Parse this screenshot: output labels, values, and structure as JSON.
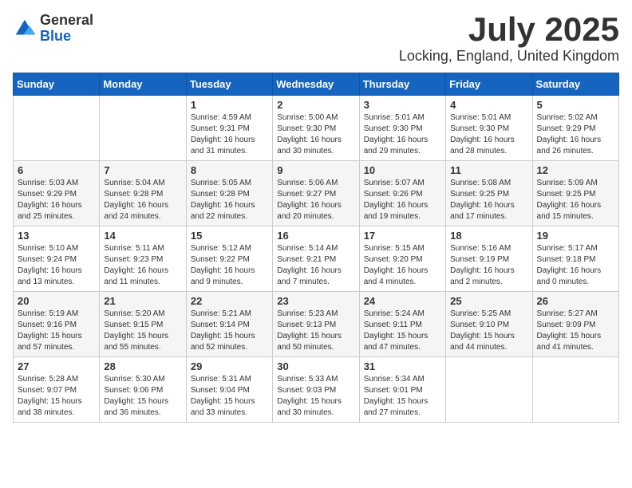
{
  "logo": {
    "general": "General",
    "blue": "Blue"
  },
  "title": {
    "month": "July 2025",
    "location": "Locking, England, United Kingdom"
  },
  "weekdays": [
    "Sunday",
    "Monday",
    "Tuesday",
    "Wednesday",
    "Thursday",
    "Friday",
    "Saturday"
  ],
  "weeks": [
    [
      {
        "day": "",
        "info": ""
      },
      {
        "day": "",
        "info": ""
      },
      {
        "day": "1",
        "info": "Sunrise: 4:59 AM\nSunset: 9:31 PM\nDaylight: 16 hours\nand 31 minutes."
      },
      {
        "day": "2",
        "info": "Sunrise: 5:00 AM\nSunset: 9:30 PM\nDaylight: 16 hours\nand 30 minutes."
      },
      {
        "day": "3",
        "info": "Sunrise: 5:01 AM\nSunset: 9:30 PM\nDaylight: 16 hours\nand 29 minutes."
      },
      {
        "day": "4",
        "info": "Sunrise: 5:01 AM\nSunset: 9:30 PM\nDaylight: 16 hours\nand 28 minutes."
      },
      {
        "day": "5",
        "info": "Sunrise: 5:02 AM\nSunset: 9:29 PM\nDaylight: 16 hours\nand 26 minutes."
      }
    ],
    [
      {
        "day": "6",
        "info": "Sunrise: 5:03 AM\nSunset: 9:29 PM\nDaylight: 16 hours\nand 25 minutes."
      },
      {
        "day": "7",
        "info": "Sunrise: 5:04 AM\nSunset: 9:28 PM\nDaylight: 16 hours\nand 24 minutes."
      },
      {
        "day": "8",
        "info": "Sunrise: 5:05 AM\nSunset: 9:28 PM\nDaylight: 16 hours\nand 22 minutes."
      },
      {
        "day": "9",
        "info": "Sunrise: 5:06 AM\nSunset: 9:27 PM\nDaylight: 16 hours\nand 20 minutes."
      },
      {
        "day": "10",
        "info": "Sunrise: 5:07 AM\nSunset: 9:26 PM\nDaylight: 16 hours\nand 19 minutes."
      },
      {
        "day": "11",
        "info": "Sunrise: 5:08 AM\nSunset: 9:25 PM\nDaylight: 16 hours\nand 17 minutes."
      },
      {
        "day": "12",
        "info": "Sunrise: 5:09 AM\nSunset: 9:25 PM\nDaylight: 16 hours\nand 15 minutes."
      }
    ],
    [
      {
        "day": "13",
        "info": "Sunrise: 5:10 AM\nSunset: 9:24 PM\nDaylight: 16 hours\nand 13 minutes."
      },
      {
        "day": "14",
        "info": "Sunrise: 5:11 AM\nSunset: 9:23 PM\nDaylight: 16 hours\nand 11 minutes."
      },
      {
        "day": "15",
        "info": "Sunrise: 5:12 AM\nSunset: 9:22 PM\nDaylight: 16 hours\nand 9 minutes."
      },
      {
        "day": "16",
        "info": "Sunrise: 5:14 AM\nSunset: 9:21 PM\nDaylight: 16 hours\nand 7 minutes."
      },
      {
        "day": "17",
        "info": "Sunrise: 5:15 AM\nSunset: 9:20 PM\nDaylight: 16 hours\nand 4 minutes."
      },
      {
        "day": "18",
        "info": "Sunrise: 5:16 AM\nSunset: 9:19 PM\nDaylight: 16 hours\nand 2 minutes."
      },
      {
        "day": "19",
        "info": "Sunrise: 5:17 AM\nSunset: 9:18 PM\nDaylight: 16 hours\nand 0 minutes."
      }
    ],
    [
      {
        "day": "20",
        "info": "Sunrise: 5:19 AM\nSunset: 9:16 PM\nDaylight: 15 hours\nand 57 minutes."
      },
      {
        "day": "21",
        "info": "Sunrise: 5:20 AM\nSunset: 9:15 PM\nDaylight: 15 hours\nand 55 minutes."
      },
      {
        "day": "22",
        "info": "Sunrise: 5:21 AM\nSunset: 9:14 PM\nDaylight: 15 hours\nand 52 minutes."
      },
      {
        "day": "23",
        "info": "Sunrise: 5:23 AM\nSunset: 9:13 PM\nDaylight: 15 hours\nand 50 minutes."
      },
      {
        "day": "24",
        "info": "Sunrise: 5:24 AM\nSunset: 9:11 PM\nDaylight: 15 hours\nand 47 minutes."
      },
      {
        "day": "25",
        "info": "Sunrise: 5:25 AM\nSunset: 9:10 PM\nDaylight: 15 hours\nand 44 minutes."
      },
      {
        "day": "26",
        "info": "Sunrise: 5:27 AM\nSunset: 9:09 PM\nDaylight: 15 hours\nand 41 minutes."
      }
    ],
    [
      {
        "day": "27",
        "info": "Sunrise: 5:28 AM\nSunset: 9:07 PM\nDaylight: 15 hours\nand 38 minutes."
      },
      {
        "day": "28",
        "info": "Sunrise: 5:30 AM\nSunset: 9:06 PM\nDaylight: 15 hours\nand 36 minutes."
      },
      {
        "day": "29",
        "info": "Sunrise: 5:31 AM\nSunset: 9:04 PM\nDaylight: 15 hours\nand 33 minutes."
      },
      {
        "day": "30",
        "info": "Sunrise: 5:33 AM\nSunset: 9:03 PM\nDaylight: 15 hours\nand 30 minutes."
      },
      {
        "day": "31",
        "info": "Sunrise: 5:34 AM\nSunset: 9:01 PM\nDaylight: 15 hours\nand 27 minutes."
      },
      {
        "day": "",
        "info": ""
      },
      {
        "day": "",
        "info": ""
      }
    ]
  ]
}
